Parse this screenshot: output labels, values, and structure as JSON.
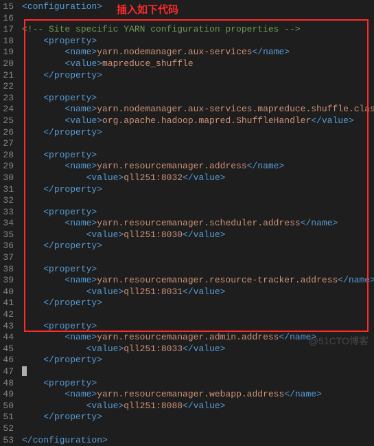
{
  "annotation": "插入如下代码",
  "watermark": "@51CTO博客",
  "startLine": 15,
  "lines": [
    {
      "type": "xml",
      "indent": 0,
      "tokens": [
        {
          "k": "tag",
          "t": "<configuration>"
        }
      ]
    },
    {
      "type": "blank"
    },
    {
      "type": "comment",
      "indent": 0,
      "text": "<!-- Site specific YARN configuration properties -->"
    },
    {
      "type": "xml",
      "indent": 1,
      "tokens": [
        {
          "k": "tag",
          "t": "<property>"
        }
      ]
    },
    {
      "type": "xml",
      "indent": 2,
      "tokens": [
        {
          "k": "tag",
          "t": "<name>"
        },
        {
          "k": "text",
          "t": "yarn.nodemanager.aux-services"
        },
        {
          "k": "tag",
          "t": "</name>"
        }
      ]
    },
    {
      "type": "xml",
      "indent": 2,
      "tokens": [
        {
          "k": "tag",
          "t": "<value>"
        },
        {
          "k": "text",
          "t": "mapreduce_shuffle"
        }
      ]
    },
    {
      "type": "xml",
      "indent": 1,
      "tokens": [
        {
          "k": "tag",
          "t": "</property>"
        }
      ]
    },
    {
      "type": "blank"
    },
    {
      "type": "xml",
      "indent": 1,
      "tokens": [
        {
          "k": "tag",
          "t": "<property>"
        }
      ]
    },
    {
      "type": "xml",
      "indent": 2,
      "tokens": [
        {
          "k": "tag",
          "t": "<name>"
        },
        {
          "k": "text",
          "t": "yarn.nodemanager.aux-services.mapreduce.shuffle.class"
        },
        {
          "k": "tag",
          "t": "</name>"
        }
      ]
    },
    {
      "type": "xml",
      "indent": 2,
      "tokens": [
        {
          "k": "tag",
          "t": "<value>"
        },
        {
          "k": "text",
          "t": "org.apache.hadoop.mapred.ShuffleHandler"
        },
        {
          "k": "tag",
          "t": "</value>"
        }
      ]
    },
    {
      "type": "xml",
      "indent": 1,
      "tokens": [
        {
          "k": "tag",
          "t": "</property>"
        }
      ]
    },
    {
      "type": "blank"
    },
    {
      "type": "xml",
      "indent": 1,
      "tokens": [
        {
          "k": "tag",
          "t": "<property>"
        }
      ]
    },
    {
      "type": "xml",
      "indent": 2,
      "tokens": [
        {
          "k": "tag",
          "t": "<name>"
        },
        {
          "k": "text",
          "t": "yarn.resourcemanager.address"
        },
        {
          "k": "tag",
          "t": "</name>"
        }
      ]
    },
    {
      "type": "xml",
      "indent": 3,
      "tokens": [
        {
          "k": "tag",
          "t": "<value>"
        },
        {
          "k": "text",
          "t": "qll251:8032"
        },
        {
          "k": "tag",
          "t": "</value>"
        }
      ]
    },
    {
      "type": "xml",
      "indent": 1,
      "tokens": [
        {
          "k": "tag",
          "t": "</property>"
        }
      ]
    },
    {
      "type": "blank"
    },
    {
      "type": "xml",
      "indent": 1,
      "tokens": [
        {
          "k": "tag",
          "t": "<property>"
        }
      ]
    },
    {
      "type": "xml",
      "indent": 2,
      "tokens": [
        {
          "k": "tag",
          "t": "<name>"
        },
        {
          "k": "text",
          "t": "yarn.resourcemanager.scheduler.address"
        },
        {
          "k": "tag",
          "t": "</name>"
        }
      ]
    },
    {
      "type": "xml",
      "indent": 3,
      "tokens": [
        {
          "k": "tag",
          "t": "<value>"
        },
        {
          "k": "text",
          "t": "qll251:8030"
        },
        {
          "k": "tag",
          "t": "</value>"
        }
      ]
    },
    {
      "type": "xml",
      "indent": 1,
      "tokens": [
        {
          "k": "tag",
          "t": "</property>"
        }
      ]
    },
    {
      "type": "blank"
    },
    {
      "type": "xml",
      "indent": 1,
      "tokens": [
        {
          "k": "tag",
          "t": "<property>"
        }
      ]
    },
    {
      "type": "xml",
      "indent": 2,
      "tokens": [
        {
          "k": "tag",
          "t": "<name>"
        },
        {
          "k": "text",
          "t": "yarn.resourcemanager.resource-tracker.address"
        },
        {
          "k": "tag",
          "t": "</name>"
        }
      ]
    },
    {
      "type": "xml",
      "indent": 3,
      "tokens": [
        {
          "k": "tag",
          "t": "<value>"
        },
        {
          "k": "text",
          "t": "qll251:8031"
        },
        {
          "k": "tag",
          "t": "</value>"
        }
      ]
    },
    {
      "type": "xml",
      "indent": 1,
      "tokens": [
        {
          "k": "tag",
          "t": "</property>"
        }
      ]
    },
    {
      "type": "blank"
    },
    {
      "type": "xml",
      "indent": 1,
      "tokens": [
        {
          "k": "tag",
          "t": "<property>"
        }
      ]
    },
    {
      "type": "xml",
      "indent": 2,
      "tokens": [
        {
          "k": "tag",
          "t": "<name>"
        },
        {
          "k": "text",
          "t": "yarn.resourcemanager.admin.address"
        },
        {
          "k": "tag",
          "t": "</name>"
        }
      ]
    },
    {
      "type": "xml",
      "indent": 3,
      "tokens": [
        {
          "k": "tag",
          "t": "<value>"
        },
        {
          "k": "text",
          "t": "qll251:8033"
        },
        {
          "k": "tag",
          "t": "</value>"
        }
      ]
    },
    {
      "type": "xml",
      "indent": 1,
      "tokens": [
        {
          "k": "tag",
          "t": "</property>"
        }
      ]
    },
    {
      "type": "cursor"
    },
    {
      "type": "xml",
      "indent": 1,
      "tokens": [
        {
          "k": "tag",
          "t": "<property>"
        }
      ]
    },
    {
      "type": "xml",
      "indent": 2,
      "tokens": [
        {
          "k": "tag",
          "t": "<name>"
        },
        {
          "k": "text",
          "t": "yarn.resourcemanager.webapp.address"
        },
        {
          "k": "tag",
          "t": "</name>"
        }
      ]
    },
    {
      "type": "xml",
      "indent": 3,
      "tokens": [
        {
          "k": "tag",
          "t": "<value>"
        },
        {
          "k": "text",
          "t": "qll251:8088"
        },
        {
          "k": "tag",
          "t": "</value>"
        }
      ]
    },
    {
      "type": "xml",
      "indent": 1,
      "tokens": [
        {
          "k": "tag",
          "t": "</property>"
        }
      ]
    },
    {
      "type": "blank"
    },
    {
      "type": "xml",
      "indent": 0,
      "tokens": [
        {
          "k": "tag",
          "t": "</configuration>"
        }
      ]
    }
  ]
}
